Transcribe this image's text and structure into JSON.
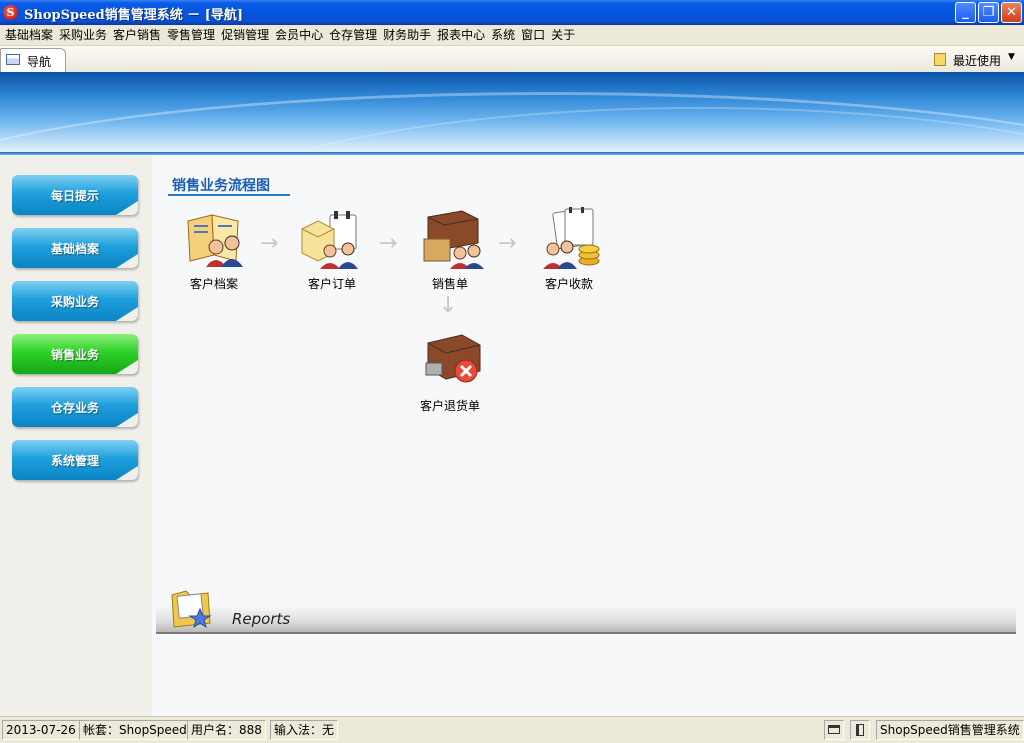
{
  "window": {
    "title": "ShopSpeed销售管理系统 － [导航]",
    "logo_letter": "S"
  },
  "menu": [
    "基础档案",
    "采购业务",
    "客户销售",
    "零售管理",
    "促销管理",
    "会员中心",
    "仓存管理",
    "财务助手",
    "报表中心",
    "系统",
    "窗口",
    "关于"
  ],
  "tabs": {
    "nav_label": "导航",
    "recent_label": "最近使用"
  },
  "sidebar": {
    "items": [
      {
        "label": "每日提示",
        "active": false
      },
      {
        "label": "基础档案",
        "active": false
      },
      {
        "label": "采购业务",
        "active": false
      },
      {
        "label": "销售业务",
        "active": true
      },
      {
        "label": "仓存业务",
        "active": false
      },
      {
        "label": "系统管理",
        "active": false
      }
    ]
  },
  "flow": {
    "title": "销售业务流程图",
    "nodes": {
      "customer_file": "客户档案",
      "customer_order": "客户订单",
      "sales_order": "销售单",
      "customer_payment": "客户收款",
      "customer_return": "客户退货单"
    }
  },
  "reports": {
    "label": "Reports"
  },
  "status": {
    "date": "2013-07-26",
    "account": "帐套：ShopSpeed",
    "user": "用户名：888",
    "input_method": "输入法：无",
    "app_name": "ShopSpeed销售管理系统"
  },
  "colors": {
    "accent": "#1a5fb0",
    "sidebar_blue": "#1fa0dc",
    "sidebar_active": "#2ed12a",
    "titlebar": "#0456e0"
  }
}
